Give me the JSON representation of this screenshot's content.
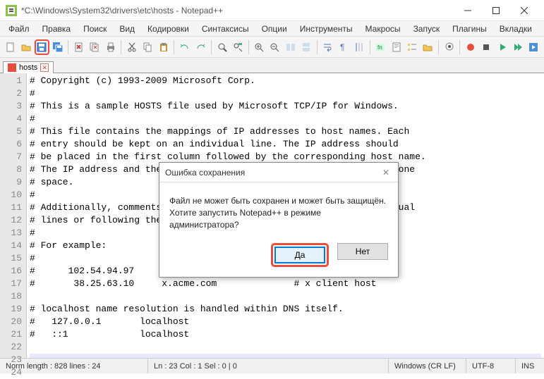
{
  "window": {
    "title": "*C:\\Windows\\System32\\drivers\\etc\\hosts - Notepad++"
  },
  "menu": {
    "items": [
      "Файл",
      "Правка",
      "Поиск",
      "Вид",
      "Кодировки",
      "Синтаксисы",
      "Опции",
      "Инструменты",
      "Макросы",
      "Запуск",
      "Плагины",
      "Вкладки",
      "?"
    ]
  },
  "tabs": {
    "items": [
      {
        "label": "hosts"
      }
    ]
  },
  "editor": {
    "lines": [
      "# Copyright (c) 1993-2009 Microsoft Corp.",
      "#",
      "# This is a sample HOSTS file used by Microsoft TCP/IP for Windows.",
      "#",
      "# This file contains the mappings of IP addresses to host names. Each",
      "# entry should be kept on an individual line. The IP address should",
      "# be placed in the first column followed by the corresponding host name.",
      "# The IP address and the host name should be separated by at least one",
      "# space.",
      "#",
      "# Additionally, comments (such as these) may be inserted on individual",
      "# lines or following the machine name denoted by a '#' symbol.",
      "#",
      "# For example:",
      "#",
      "#      102.54.94.97     rhino.acme.com          # source server",
      "#       38.25.63.10     x.acme.com              # x client host",
      "",
      "# localhost name resolution is handled within DNS itself.",
      "#   127.0.0.1       localhost",
      "#   ::1             localhost",
      "",
      ""
    ],
    "current_line": 23,
    "line_count": 24
  },
  "dialog": {
    "title": "Ошибка сохранения",
    "line1": "Файл не может быть сохранен и может быть защищён.",
    "line2": "Хотите запустить Notepad++ в режиме администратора?",
    "yes": "Да",
    "no": "Нет"
  },
  "status": {
    "left": "Norm  length : 828    lines : 24",
    "mid": "Ln : 23   Col : 1   Sel : 0 | 0",
    "eol": "Windows (CR LF)",
    "enc": "UTF-8",
    "mode": "INS"
  }
}
